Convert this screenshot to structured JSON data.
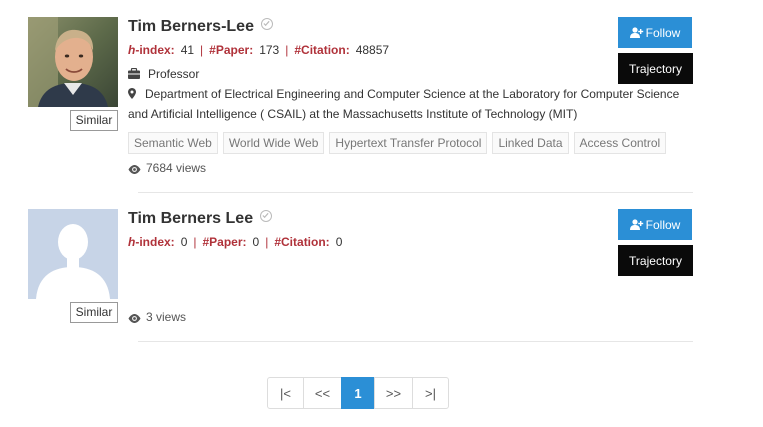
{
  "results": [
    {
      "name": "Tim Berners-Lee",
      "h_index_label_italic": "h",
      "h_index_label_rest": "-index:",
      "h_index": "41",
      "paper_label": "#Paper:",
      "papers": "173",
      "citation_label": "#Citation:",
      "citations": "48857",
      "position": "Professor",
      "affiliation": "Department of Electrical Engineering and Computer Science at the Laboratory for Computer Science and Artificial Intelligence ( CSAIL) at the Massachusetts Institute of Technology (MIT)",
      "tags": [
        "Semantic Web",
        "World Wide Web",
        "Hypertext Transfer Protocol",
        "Linked Data",
        "Access Control"
      ],
      "views": "7684 views",
      "similar_label": "Similar",
      "follow_label": "Follow",
      "trajectory_label": "Trajectory",
      "avatar_icon": "person-photo"
    },
    {
      "name": "Tim Berners Lee",
      "h_index_label_italic": "h",
      "h_index_label_rest": "-index:",
      "h_index": "0",
      "paper_label": "#Paper:",
      "papers": "0",
      "citation_label": "#Citation:",
      "citations": "0",
      "views": "3 views",
      "similar_label": "Similar",
      "follow_label": "Follow",
      "trajectory_label": "Trajectory",
      "avatar_icon": "default-avatar-silhouette"
    }
  ],
  "pagination": {
    "first": "|<",
    "prev": "<<",
    "current": "1",
    "next": ">>",
    "last": ">|"
  },
  "colors": {
    "accent": "#2b8fd6",
    "stat_label": "#b0323a",
    "trajectory_bg": "#0a0a0a"
  },
  "icons": [
    "verified-check-icon",
    "briefcase-icon",
    "map-pin-icon",
    "eye-icon",
    "add-user-icon"
  ]
}
